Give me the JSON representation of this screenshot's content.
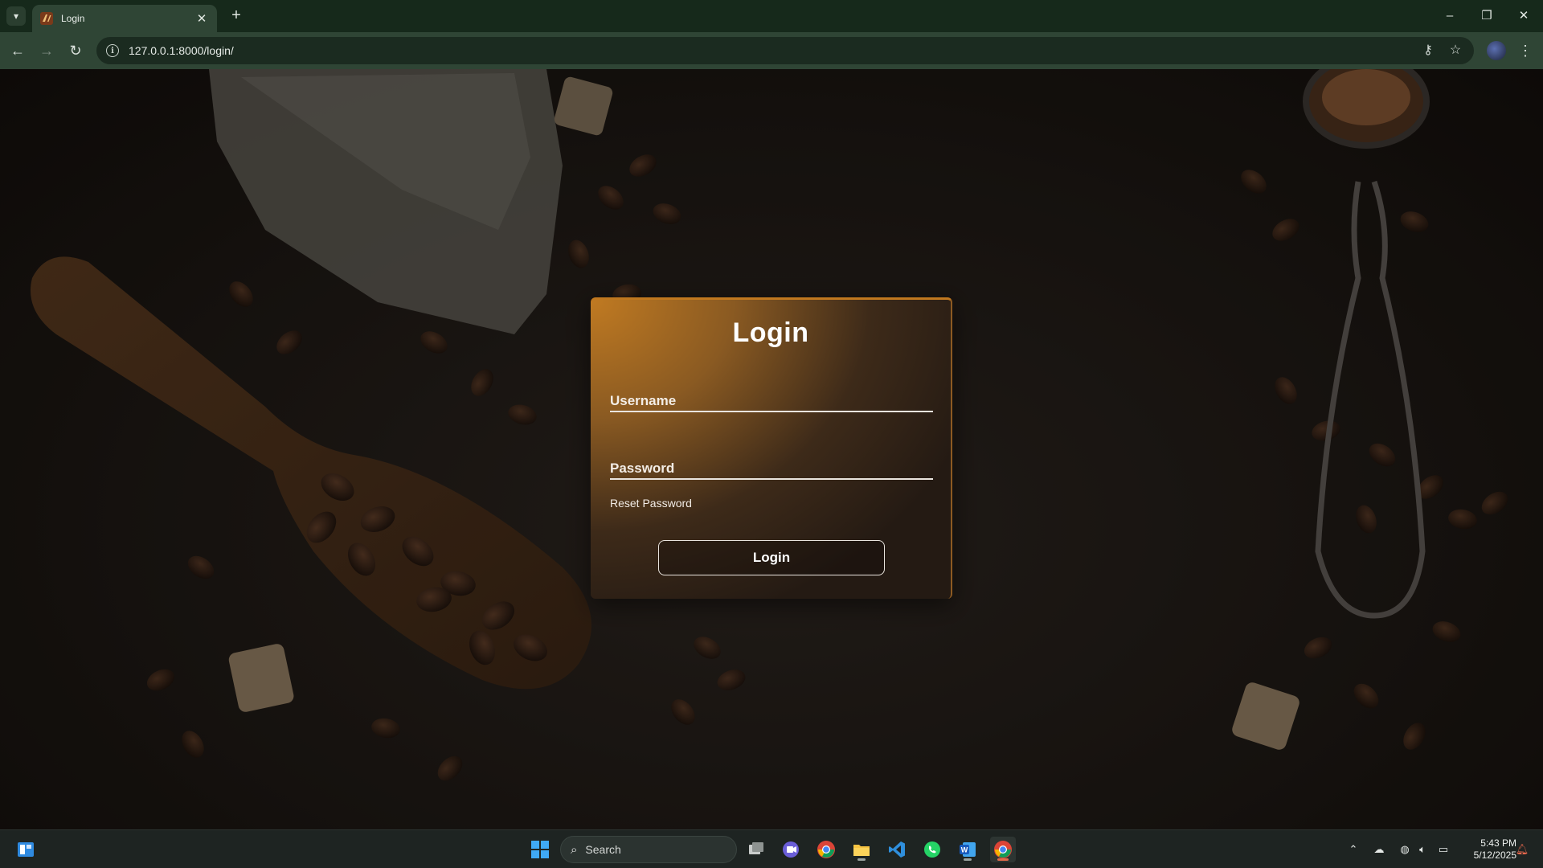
{
  "browser": {
    "tab_title": "Login",
    "url": "127.0.0.1:8000/login/",
    "window_controls": {
      "minimize": "–",
      "restore": "❐",
      "close": "✕"
    }
  },
  "login": {
    "title": "Login",
    "username_label": "Username",
    "password_label": "Password",
    "reset_password": "Reset Password",
    "submit": "Login"
  },
  "taskbar": {
    "search_placeholder": "Search",
    "time": "5:43 PM",
    "date": "5/12/2025",
    "apps": [
      "start-icon",
      "search",
      "task-view-icon",
      "meet-icon",
      "chrome-icon",
      "file-explorer-icon",
      "vscode-icon",
      "whatsapp-icon",
      "word-icon",
      "chrome-active-icon"
    ]
  },
  "colors": {
    "card_accent": "#c0781f",
    "browser_frame": "#16291b",
    "toolbar": "#2f4535"
  }
}
